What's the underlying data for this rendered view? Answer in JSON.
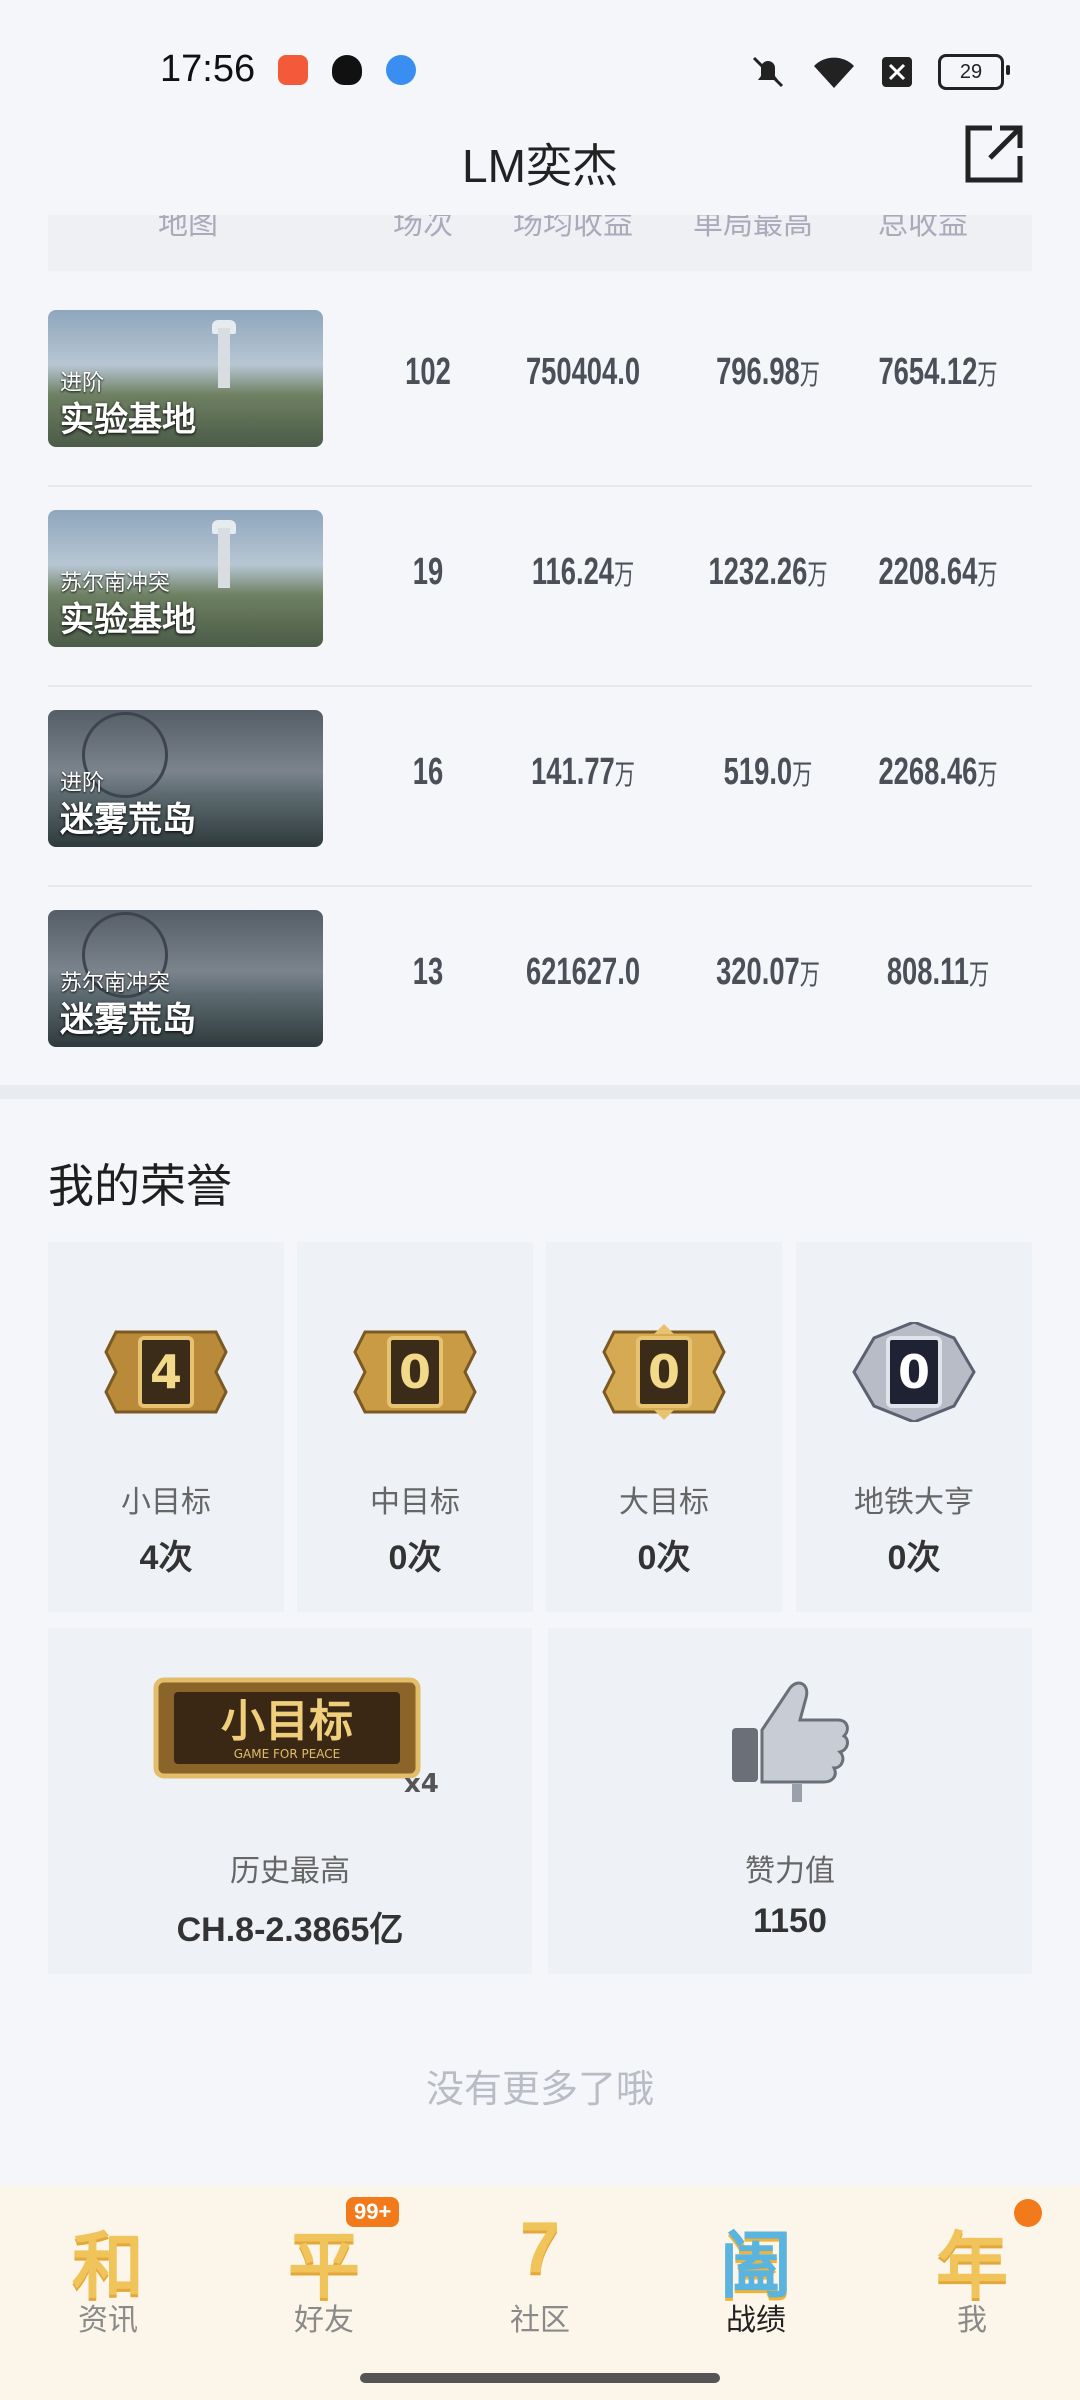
{
  "status_bar": {
    "time": "17:56",
    "battery": "29"
  },
  "title": "LM奕杰",
  "table": {
    "headers": [
      "地图",
      "场次",
      "场均收益",
      "单局最高",
      "总收益"
    ],
    "rows": [
      {
        "map_sub": "进阶",
        "map_name": "实验基地",
        "thumb": "base",
        "matches": "102",
        "avg": "750404.0",
        "avg_unit": "",
        "max": "796.98",
        "max_unit": "万",
        "total": "7654.12",
        "total_unit": "万"
      },
      {
        "map_sub": "苏尔南冲突",
        "map_name": "实验基地",
        "thumb": "base",
        "matches": "19",
        "avg": "116.24",
        "avg_unit": "万",
        "max": "1232.26",
        "max_unit": "万",
        "total": "2208.64",
        "total_unit": "万"
      },
      {
        "map_sub": "进阶",
        "map_name": "迷雾荒岛",
        "thumb": "fog",
        "matches": "16",
        "avg": "141.77",
        "avg_unit": "万",
        "max": "519.0",
        "max_unit": "万",
        "total": "2268.46",
        "total_unit": "万"
      },
      {
        "map_sub": "苏尔南冲突",
        "map_name": "迷雾荒岛",
        "thumb": "fog",
        "matches": "13",
        "avg": "621627.0",
        "avg_unit": "",
        "max": "320.07",
        "max_unit": "万",
        "total": "808.11",
        "total_unit": "万"
      }
    ]
  },
  "honors": {
    "title": "我的荣誉",
    "cards": [
      {
        "badge": "4",
        "label": "小目标",
        "count": "4次"
      },
      {
        "badge": "0",
        "label": "中目标",
        "count": "0次"
      },
      {
        "badge": "0",
        "label": "大目标",
        "count": "0次"
      },
      {
        "badge": "0",
        "label": "地铁大亨",
        "count": "0次"
      }
    ],
    "history": {
      "emblem_text": "小目标",
      "emblem_sub": "GAME FOR PEACE",
      "emblem_mult": "x4",
      "label": "历史最高",
      "value": "CH.8-2.3865亿"
    },
    "likes": {
      "label": "赞力值",
      "value": "1150"
    }
  },
  "end_text": "没有更多了哦",
  "nav": [
    {
      "glyph": "和",
      "label": "资讯"
    },
    {
      "glyph": "平",
      "label": "好友",
      "badge": "99+"
    },
    {
      "glyph": "7",
      "label": "社区"
    },
    {
      "glyph": "阖",
      "label": "战绩",
      "active": true
    },
    {
      "glyph": "年",
      "label": "我",
      "dot": true
    }
  ],
  "colors": {
    "accent": "#f27a1a",
    "nav_bg": "#fcf6ea",
    "gold": "#c9a04a"
  }
}
